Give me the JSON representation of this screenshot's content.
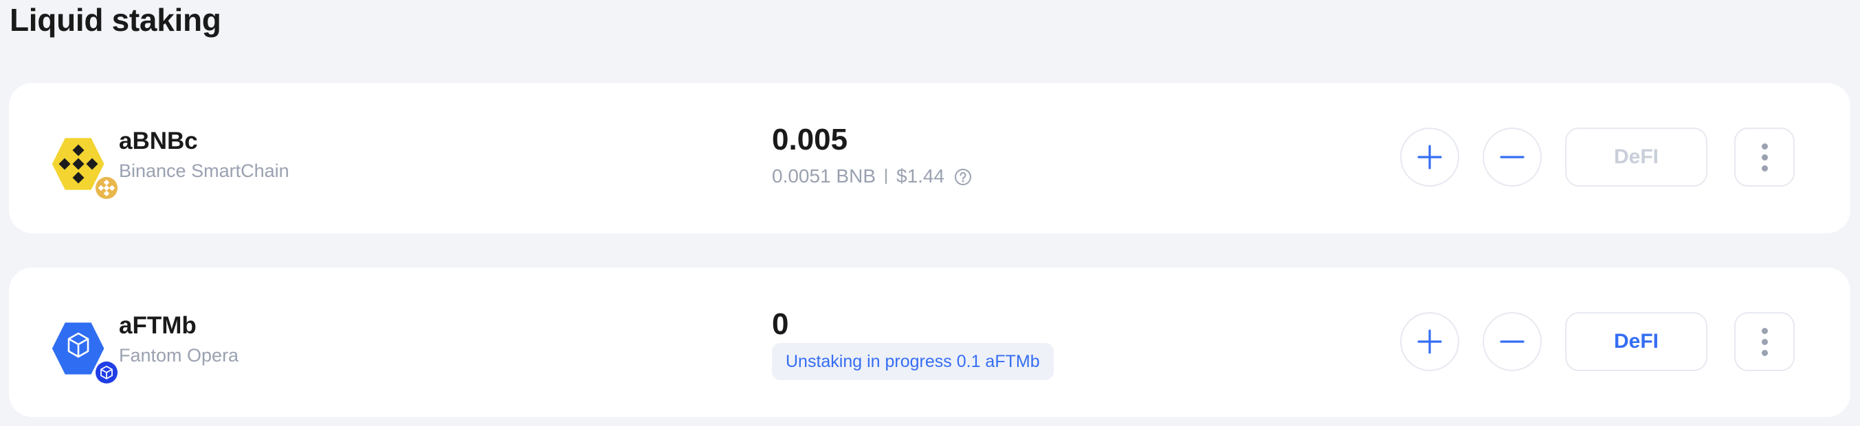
{
  "page": {
    "title": "Liquid staking"
  },
  "colors": {
    "accent": "#356df3",
    "muted": "#9aa1b0",
    "bnb": "#f3d430",
    "ftm": "#2f6ef2"
  },
  "items": [
    {
      "token": "aBNBc",
      "network": "Binance SmartChain",
      "logo_icon": "bnb-icon",
      "amount": "0.005",
      "sub_value": "0.0051 BNB",
      "usd_value": "$1.44",
      "defi_label": "DeFI",
      "defi_enabled": false
    },
    {
      "token": "aFTMb",
      "network": "Fantom Opera",
      "logo_icon": "fantom-icon",
      "amount": "0",
      "unstaking_text": "Unstaking in progress 0.1 aFTMb",
      "defi_label": "DeFI",
      "defi_enabled": true
    }
  ]
}
